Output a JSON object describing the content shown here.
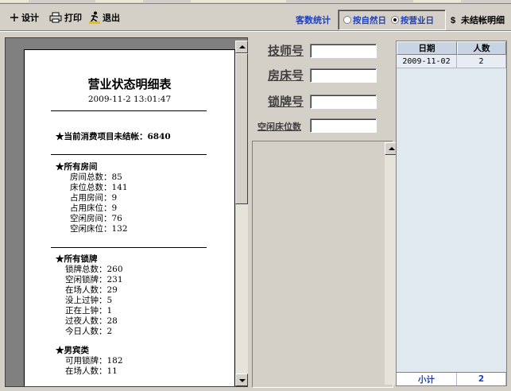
{
  "toolbar": {
    "design_label": "设计",
    "print_label": "打印",
    "exit_label": "退出",
    "stat_label": "客数统计",
    "radio_natural_day": "按自然日",
    "radio_business_day": "按营业日",
    "selected_mode": "按营业日",
    "unsettled_label": "未结帐明细"
  },
  "report": {
    "title": "营业状态明细表",
    "datetime": "2009-11-2 13:01:47",
    "unsettled_line": "★当前消费项目未结帐：6840",
    "rooms_head": "★所有房间",
    "rooms_total": "房间总数：85",
    "beds_total": "床位总数：141",
    "rooms_occupied": "占用房间：9",
    "beds_occupied": "占用床位：9",
    "rooms_free": "空闲房间：76",
    "beds_free": "空闲床位：132",
    "tags_head": "★所有锁牌",
    "tags_total": "锁牌总数：260",
    "tags_free": "空闲锁牌：231",
    "present_count": "在场人数：29",
    "not_clocked": "没上过钟：5",
    "clocking": "正在上钟：1",
    "overnight": "过夜人数：28",
    "today_count": "今日人数：2",
    "male_head": "★男宾类",
    "male_tags_available": "可用锁牌：182",
    "male_present": "在场人数：11"
  },
  "search": {
    "technician_label": "技师号",
    "technician_value": "",
    "room_label": "房床号",
    "room_value": "",
    "tag_label": "锁牌号",
    "tag_value": "",
    "free_beds_label": "空闲床位数",
    "free_beds_value": ""
  },
  "grid": {
    "columns": [
      "日期",
      "人数"
    ],
    "rows": [
      {
        "date": "2009-11-02",
        "count": "2"
      }
    ],
    "footer_label": "小计",
    "footer_value": "2"
  },
  "colors": {
    "accent_blue": "#1b3fbf",
    "window_bg": "#d4d0c8"
  }
}
